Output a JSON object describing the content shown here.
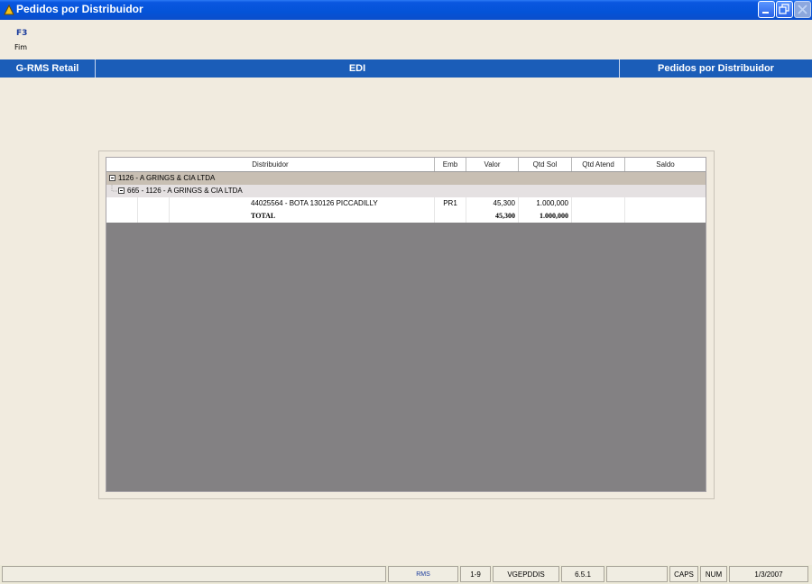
{
  "window": {
    "title": "Pedidos por Distribuidor"
  },
  "menu": {
    "key": "F3",
    "label": "Fim"
  },
  "header_bar": {
    "left": "G-RMS Retail",
    "center": "EDI",
    "right": "Pedidos por Distribuidor"
  },
  "grid": {
    "columns": [
      "Distribuidor",
      "Emb",
      "Valor",
      "Qtd Sol",
      "Qtd Atend",
      "Saldo"
    ],
    "group1": "1126 - A GRINGS & CIA LTDA",
    "group2": "665 - 1126 - A GRINGS & CIA LTDA",
    "rows": [
      {
        "distribuidor": "44025564 - BOTA 130126 PICCADILLY",
        "emb": "PR1",
        "valor": "45,300",
        "qtd_sol": "1.000,000",
        "qtd_atend": "",
        "saldo": ""
      }
    ],
    "total": {
      "label": "TOTAL",
      "valor": "45,300",
      "qtd_sol": "1.000,000"
    }
  },
  "statusbar": {
    "rms": "RMS",
    "range": "1-9",
    "program": "VGEPDDIS",
    "version": "6.5.1",
    "caps": "CAPS",
    "num": "NUM",
    "date": "1/3/2007"
  }
}
